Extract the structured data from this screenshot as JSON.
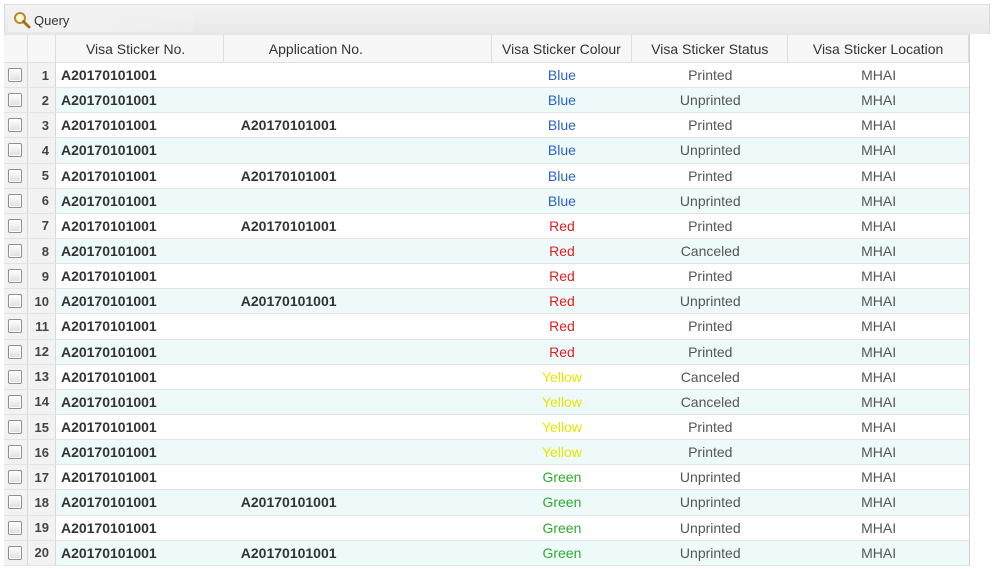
{
  "toolbar": {
    "query_label": "Query",
    "query_icon": "search-icon"
  },
  "columns": {
    "visa_sticker_no": "Visa Sticker No.",
    "application_no": "Application No.",
    "colour": "Visa Sticker Colour",
    "status": "Visa Sticker Status",
    "location": "Visa Sticker Location"
  },
  "colour_map": {
    "Blue": "#2b62c9",
    "Red": "#e02020",
    "Yellow": "#e6e600",
    "Green": "#2eaa2e"
  },
  "rows": [
    {
      "num": "1",
      "sticker_no": "A20170101001",
      "app_no": "",
      "colour": "Blue",
      "status": "Printed",
      "location": "MHAI"
    },
    {
      "num": "2",
      "sticker_no": "A20170101001",
      "app_no": "",
      "colour": "Blue",
      "status": "Unprinted",
      "location": "MHAI"
    },
    {
      "num": "3",
      "sticker_no": "A20170101001",
      "app_no": "A20170101001",
      "colour": "Blue",
      "status": "Printed",
      "location": "MHAI"
    },
    {
      "num": "4",
      "sticker_no": "A20170101001",
      "app_no": "",
      "colour": "Blue",
      "status": "Unprinted",
      "location": "MHAI"
    },
    {
      "num": "5",
      "sticker_no": "A20170101001",
      "app_no": "A20170101001",
      "colour": "Blue",
      "status": "Printed",
      "location": "MHAI"
    },
    {
      "num": "6",
      "sticker_no": "A20170101001",
      "app_no": "",
      "colour": "Blue",
      "status": "Unprinted",
      "location": "MHAI"
    },
    {
      "num": "7",
      "sticker_no": "A20170101001",
      "app_no": "A20170101001",
      "colour": "Red",
      "status": "Printed",
      "location": "MHAI"
    },
    {
      "num": "8",
      "sticker_no": "A20170101001",
      "app_no": "",
      "colour": "Red",
      "status": "Canceled",
      "location": "MHAI"
    },
    {
      "num": "9",
      "sticker_no": "A20170101001",
      "app_no": "",
      "colour": "Red",
      "status": "Printed",
      "location": "MHAI"
    },
    {
      "num": "10",
      "sticker_no": "A20170101001",
      "app_no": "A20170101001",
      "colour": "Red",
      "status": "Unprinted",
      "location": "MHAI"
    },
    {
      "num": "11",
      "sticker_no": "A20170101001",
      "app_no": "",
      "colour": "Red",
      "status": "Printed",
      "location": "MHAI"
    },
    {
      "num": "12",
      "sticker_no": "A20170101001",
      "app_no": "",
      "colour": "Red",
      "status": "Printed",
      "location": "MHAI"
    },
    {
      "num": "13",
      "sticker_no": "A20170101001",
      "app_no": "",
      "colour": "Yellow",
      "status": "Canceled",
      "location": "MHAI"
    },
    {
      "num": "14",
      "sticker_no": "A20170101001",
      "app_no": "",
      "colour": "Yellow",
      "status": "Canceled",
      "location": "MHAI"
    },
    {
      "num": "15",
      "sticker_no": "A20170101001",
      "app_no": "",
      "colour": "Yellow",
      "status": "Printed",
      "location": "MHAI"
    },
    {
      "num": "16",
      "sticker_no": "A20170101001",
      "app_no": "",
      "colour": "Yellow",
      "status": "Printed",
      "location": "MHAI"
    },
    {
      "num": "17",
      "sticker_no": "A20170101001",
      "app_no": "",
      "colour": "Green",
      "status": "Unprinted",
      "location": "MHAI"
    },
    {
      "num": "18",
      "sticker_no": "A20170101001",
      "app_no": "A20170101001",
      "colour": "Green",
      "status": "Unprinted",
      "location": "MHAI"
    },
    {
      "num": "19",
      "sticker_no": "A20170101001",
      "app_no": "",
      "colour": "Green",
      "status": "Unprinted",
      "location": "MHAI"
    },
    {
      "num": "20",
      "sticker_no": "A20170101001",
      "app_no": "A20170101001",
      "colour": "Green",
      "status": "Unprinted",
      "location": "MHAI"
    }
  ]
}
